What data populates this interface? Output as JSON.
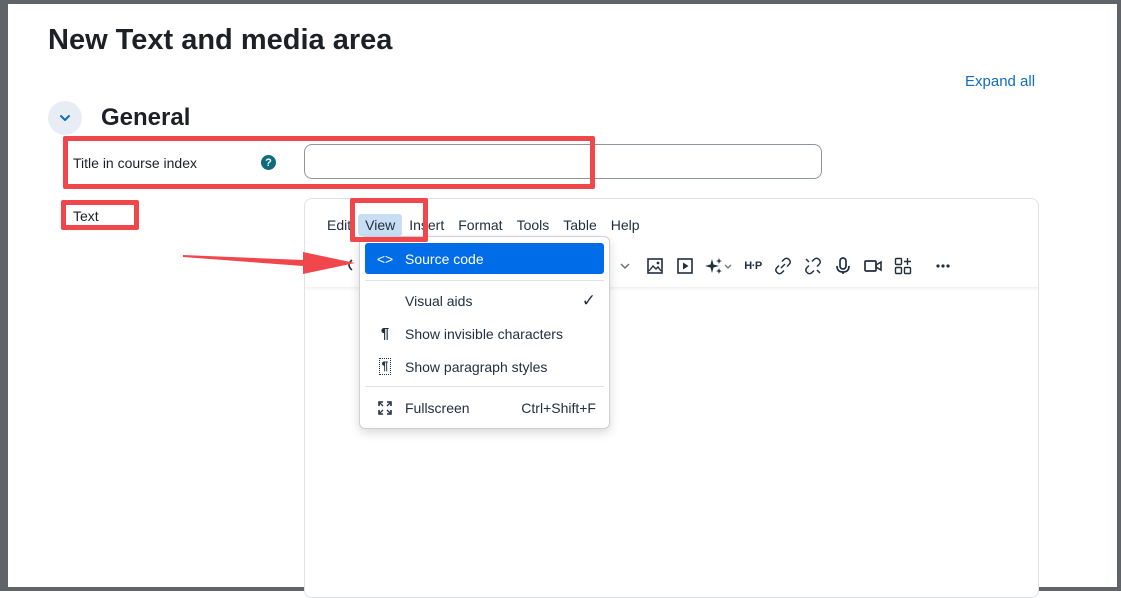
{
  "page": {
    "title": "New Text and media area",
    "expand_all": "Expand all"
  },
  "section": {
    "title": "General"
  },
  "form": {
    "title_label": "Title in course index",
    "help_glyph": "?",
    "title_value": "",
    "text_label": "Text"
  },
  "editor": {
    "menubar": [
      "Edit",
      "View",
      "Insert",
      "Format",
      "Tools",
      "Table",
      "Help"
    ],
    "active_menu": "View",
    "toolbar_icons": [
      "chevron-down-icon",
      "image-icon",
      "media-icon",
      "ai-sparkle-icon",
      "h5p-icon",
      "link-icon",
      "unlink-icon",
      "microphone-icon",
      "video-camera-icon",
      "add-block-icon",
      "more-icon"
    ]
  },
  "view_menu": {
    "items": [
      {
        "icon": "source-code-icon",
        "glyph": "<>",
        "label": "Source code",
        "shortcut": "",
        "selected": true
      },
      {
        "icon": "none",
        "glyph": "",
        "label": "Visual aids",
        "shortcut": "✓",
        "selected": false
      },
      {
        "icon": "pilcrow-icon",
        "glyph": "¶",
        "label": "Show invisible characters",
        "shortcut": "",
        "selected": false
      },
      {
        "icon": "paragraph-styles-icon",
        "glyph": "¶",
        "label": "Show paragraph styles",
        "shortcut": "",
        "selected": false
      },
      {
        "icon": "fullscreen-icon",
        "glyph": "⛶",
        "label": "Fullscreen",
        "shortcut": "Ctrl+Shift+F",
        "selected": false
      }
    ]
  },
  "colors": {
    "highlight": "#f0474d",
    "link": "#0f6cbf",
    "menu_selected": "#006ce7",
    "menubar_active": "#c8def4"
  }
}
